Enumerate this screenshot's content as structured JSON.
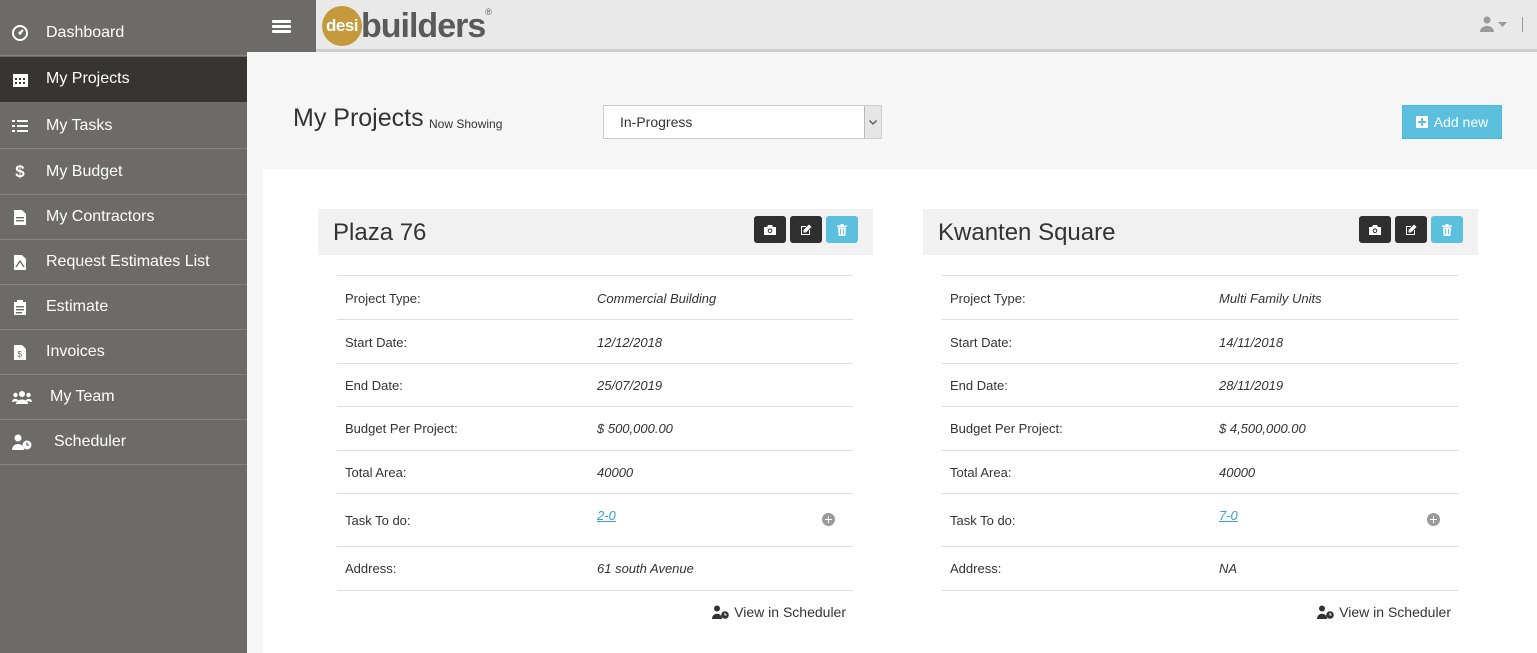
{
  "sidebar": {
    "items": [
      {
        "label": "Dashboard",
        "icon": "dashboard-icon"
      },
      {
        "label": "My Projects",
        "icon": "calendar-icon"
      },
      {
        "label": "My Tasks",
        "icon": "tasks-icon"
      },
      {
        "label": "My Budget",
        "icon": "dollar-icon"
      },
      {
        "label": "My Contractors",
        "icon": "document-icon"
      },
      {
        "label": "Request Estimates List",
        "icon": "pdf-file-icon"
      },
      {
        "label": "Estimate",
        "icon": "clipboard-icon"
      },
      {
        "label": "Invoices",
        "icon": "invoice-icon"
      },
      {
        "label": "My Team",
        "icon": "team-icon"
      },
      {
        "label": "Scheduler",
        "icon": "user-clock-icon"
      }
    ],
    "active": "My Projects"
  },
  "topbar": {
    "logo_circle": "desi",
    "logo_text": "builders",
    "logo_reg": "®"
  },
  "header": {
    "title": "My Projects",
    "subtitle": "Now Showing",
    "status_selected": "In-Progress",
    "add_label": "Add new"
  },
  "projects": [
    {
      "name": "Plaza 76",
      "fields": [
        {
          "label": "Project Type:",
          "value": "Commercial Building"
        },
        {
          "label": "Start Date:",
          "value": "12/12/2018"
        },
        {
          "label": "End Date:",
          "value": "25/07/2019"
        },
        {
          "label": "Budget Per Project:",
          "value": "$ 500,000.00"
        },
        {
          "label": "Total Area:",
          "value": "40000"
        },
        {
          "label": "Task To do:",
          "value": "2-0"
        },
        {
          "label": "Address:",
          "value": "61 south Avenue"
        }
      ],
      "scheduler_label": "View in Scheduler"
    },
    {
      "name": "Kwanten Square",
      "fields": [
        {
          "label": "Project Type:",
          "value": "Multi Family Units"
        },
        {
          "label": "Start Date:",
          "value": "14/11/2018"
        },
        {
          "label": "End Date:",
          "value": "28/11/2019"
        },
        {
          "label": "Budget Per Project:",
          "value": "$ 4,500,000.00"
        },
        {
          "label": "Total Area:",
          "value": "40000"
        },
        {
          "label": "Task To do:",
          "value": "7-0"
        },
        {
          "label": "Address:",
          "value": "NA"
        }
      ],
      "scheduler_label": "View in Scheduler"
    }
  ],
  "colors": {
    "sidebar_bg": "#6d6b6a",
    "sidebar_active": "#373534",
    "accent": "#5bc0de",
    "logo_gold": "#c59a3a"
  }
}
